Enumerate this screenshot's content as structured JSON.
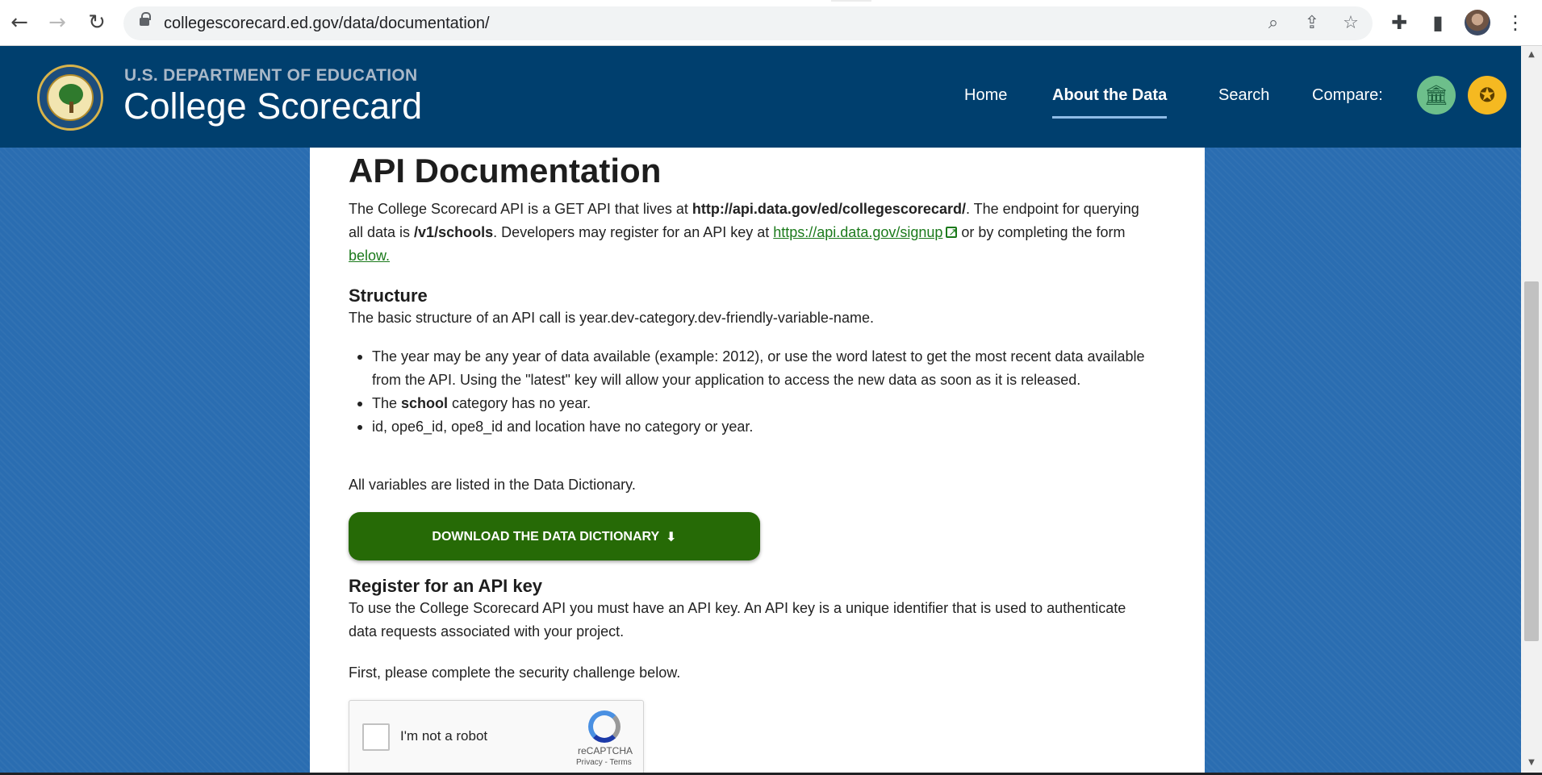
{
  "browser": {
    "url": "collegescorecard.ed.gov/data/documentation/",
    "back_icon": "←",
    "forward_icon": "→",
    "reload_icon": "↻",
    "zoom_icon": "⌕",
    "share_icon": "⇪",
    "star_icon": "☆",
    "extensions_icon": "✚",
    "sidepanel_icon": "▮",
    "menu_icon": "⋮"
  },
  "header": {
    "department": "U.S. DEPARTMENT OF EDUCATION",
    "site_name": "College Scorecard",
    "nav": {
      "home": "Home",
      "about": "About the Data",
      "search": "Search",
      "compare": "Compare:"
    },
    "school_icon": "🏛",
    "award_icon": "✪"
  },
  "main": {
    "title": "API Documentation",
    "intro": {
      "p1": "The College Scorecard API is a GET API that lives at ",
      "api_url": "http://api.data.gov/ed/collegescorecard/",
      "p2": ". The endpoint for querying all data is ",
      "endpoint": "/v1/schools",
      "p3": ". Developers may register for an API key at ",
      "signup_link": "https://api.data.gov/signup",
      "p4": " or by completing the form ",
      "below_link": "below."
    },
    "structure": {
      "heading": "Structure",
      "text": "The basic structure of an API call is year.dev-category.dev-friendly-variable-name.",
      "bullet1": "The year may be any year of data available (example: 2012), or use the word latest to get the most recent data available from the API. Using the \"latest\" key will allow your application to access the new data as soon as it is released.",
      "bullet2_pre": "The ",
      "bullet2_bold": "school",
      "bullet2_post": " category has no year.",
      "bullet3": "id, ope6_id, ope8_id and location have no category or year."
    },
    "all_variables": "All variables are listed in the Data Dictionary.",
    "download_button": "DOWNLOAD THE DATA DICTIONARY",
    "download_icon": "⬇",
    "register": {
      "heading": "Register for an API key",
      "text": "To use the College Scorecard API you must have an API key. An API key is a unique identifier that is used to authenticate data requests associated with your project.",
      "security": "First, please complete the security challenge below."
    },
    "captcha": {
      "label": "I'm not a robot",
      "brand": "reCAPTCHA",
      "terms": "Privacy - Terms"
    }
  },
  "scrollbar": {
    "up_icon": "▲",
    "down_icon": "▼"
  }
}
